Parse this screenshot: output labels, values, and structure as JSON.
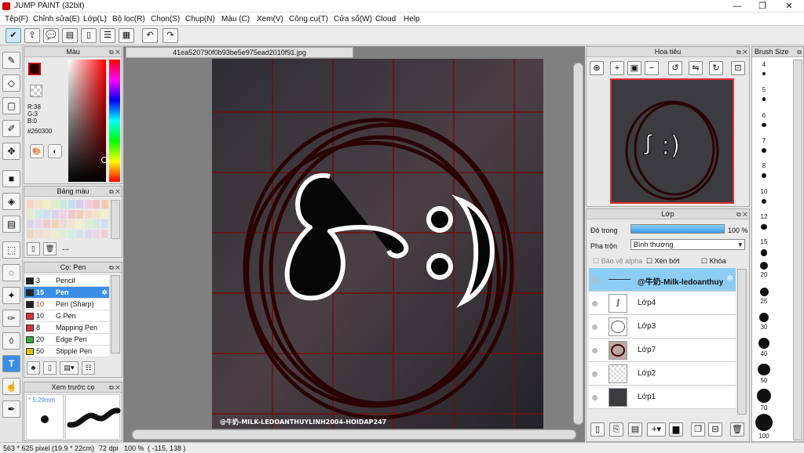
{
  "window": {
    "title": "JUMP PAINT (32bit)",
    "minimize": "—",
    "maximize": "❐",
    "close": "✕"
  },
  "menu": [
    "Tệp(F)",
    "Chỉnh sửa(E)",
    "Lớp(L)",
    "Bộ lọc(R)",
    "Chọn(S)",
    "Chụp(N)",
    "Màu (C)",
    "Xem(V)",
    "Công cụ(T)",
    "Cửa sổ(W)",
    "Cloud",
    "Help"
  ],
  "toolbar": {
    "undo": "↶",
    "redo": "↷"
  },
  "color_panel": {
    "title": "Màu",
    "r": "R:38",
    "g": "G:3",
    "b": "B:0",
    "hex": "#260300",
    "fg": "#260300"
  },
  "palette_panel": {
    "title": "Bảng màu",
    "dashes": "---"
  },
  "brush_panel": {
    "title": "Cọ: Pen",
    "brushes": [
      {
        "size": "3",
        "name": "Pencil",
        "color": "#222222"
      },
      {
        "size": "15",
        "name": "Pen",
        "color": "#222222"
      },
      {
        "size": "10",
        "name": "Pen (Sharp)",
        "color": "#222222"
      },
      {
        "size": "10",
        "name": "G Pen",
        "color": "#e03030"
      },
      {
        "size": "8",
        "name": "Mapping Pen",
        "color": "#e03030"
      },
      {
        "size": "20",
        "name": "Edge Pen",
        "color": "#30b030"
      },
      {
        "size": "50",
        "name": "Stipple Pen",
        "color": "#e0c000"
      }
    ]
  },
  "preview_panel": {
    "title": "Xem trước cọ",
    "size": "* 5.29mm"
  },
  "canvas": {
    "tab": "41ea520790f0b93be5e975ead2010f91.jpg",
    "watermark": "@牛奶-MILK-LEDOANTHUYLINH2004-HOIDAP247",
    "art_text": "ꭍ :)"
  },
  "navigator": {
    "title": "Hoa tiêu"
  },
  "layers_panel": {
    "title": "Lớp",
    "opacity_label": "Độ trong",
    "opacity_value": "100 %",
    "opacity_fraction": 1.0,
    "blend_label": "Pha trộn",
    "blend_value": "Bình thường",
    "protect_alpha": "Bảo vệ alpha",
    "clip": "Xén bớt",
    "lock": "Khóa",
    "layers": [
      {
        "name": "@牛奶-Milk-ledoanthuy"
      },
      {
        "name": "Lớp4"
      },
      {
        "name": "Lớp3"
      },
      {
        "name": "Lớp7"
      },
      {
        "name": "Lớp2"
      },
      {
        "name": "Lớp1"
      }
    ]
  },
  "brush_size_panel": {
    "title": "Brush Size",
    "sizes": [
      "4",
      "5",
      "6",
      "7",
      "8",
      "10",
      "12",
      "15",
      "20",
      "25",
      "30",
      "40",
      "50",
      "70",
      "100"
    ]
  },
  "status": {
    "dimensions": "563 * 625 pixel",
    "physical": "(19.9 * 22cm)",
    "dpi": "72 dpi",
    "zoom": "100 %",
    "coords": "( -115, 138 )"
  }
}
